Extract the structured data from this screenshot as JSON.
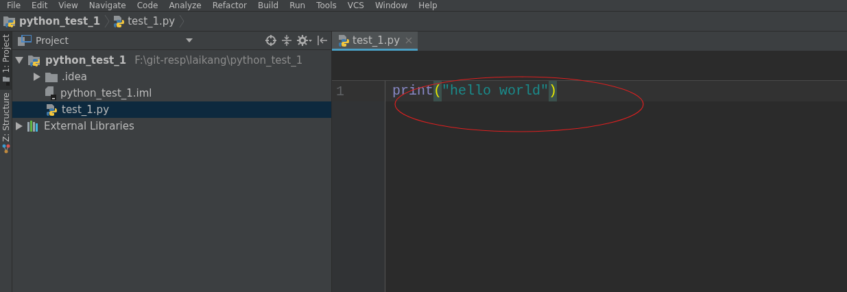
{
  "menu": [
    {
      "label": "File"
    },
    {
      "label": "Edit"
    },
    {
      "label": "View"
    },
    {
      "label": "Navigate"
    },
    {
      "label": "Code"
    },
    {
      "label": "Analyze"
    },
    {
      "label": "Refactor"
    },
    {
      "label": "Build"
    },
    {
      "label": "Run"
    },
    {
      "label": "Tools"
    },
    {
      "label": "VCS"
    },
    {
      "label": "Window"
    },
    {
      "label": "Help"
    }
  ],
  "breadcrumbs": [
    {
      "label": "python_test_1",
      "kind": "project"
    },
    {
      "label": "test_1.py",
      "kind": "python"
    }
  ],
  "tool_tabs": [
    {
      "label": "1: Project",
      "kind": "project",
      "selected": true
    },
    {
      "label": "Z: Structure",
      "kind": "structure",
      "selected": false
    }
  ],
  "project_panel": {
    "title": "Project",
    "tree": [
      {
        "label": "python_test_1",
        "path": "F:\\git-resp\\laikang\\python_test_1",
        "kind": "project",
        "expanded": true,
        "selected": false,
        "children": [
          {
            "label": ".idea",
            "kind": "folder",
            "expanded": false,
            "selected": false
          },
          {
            "label": "python_test_1.iml",
            "kind": "iml",
            "selected": false
          },
          {
            "label": "test_1.py",
            "kind": "python",
            "selected": true
          }
        ]
      },
      {
        "label": "External Libraries",
        "kind": "library",
        "expanded": false,
        "selected": false
      }
    ]
  },
  "editor": {
    "tabs": [
      {
        "label": "test_1.py",
        "kind": "python",
        "selected": true
      }
    ],
    "lines": [
      {
        "number": "1",
        "tokens": [
          {
            "text": "print",
            "kind": "builtin"
          },
          {
            "text": "(",
            "kind": "paren"
          },
          {
            "text": "\"hello world\"",
            "kind": "string"
          },
          {
            "text": ")",
            "kind": "paren"
          }
        ]
      }
    ]
  }
}
